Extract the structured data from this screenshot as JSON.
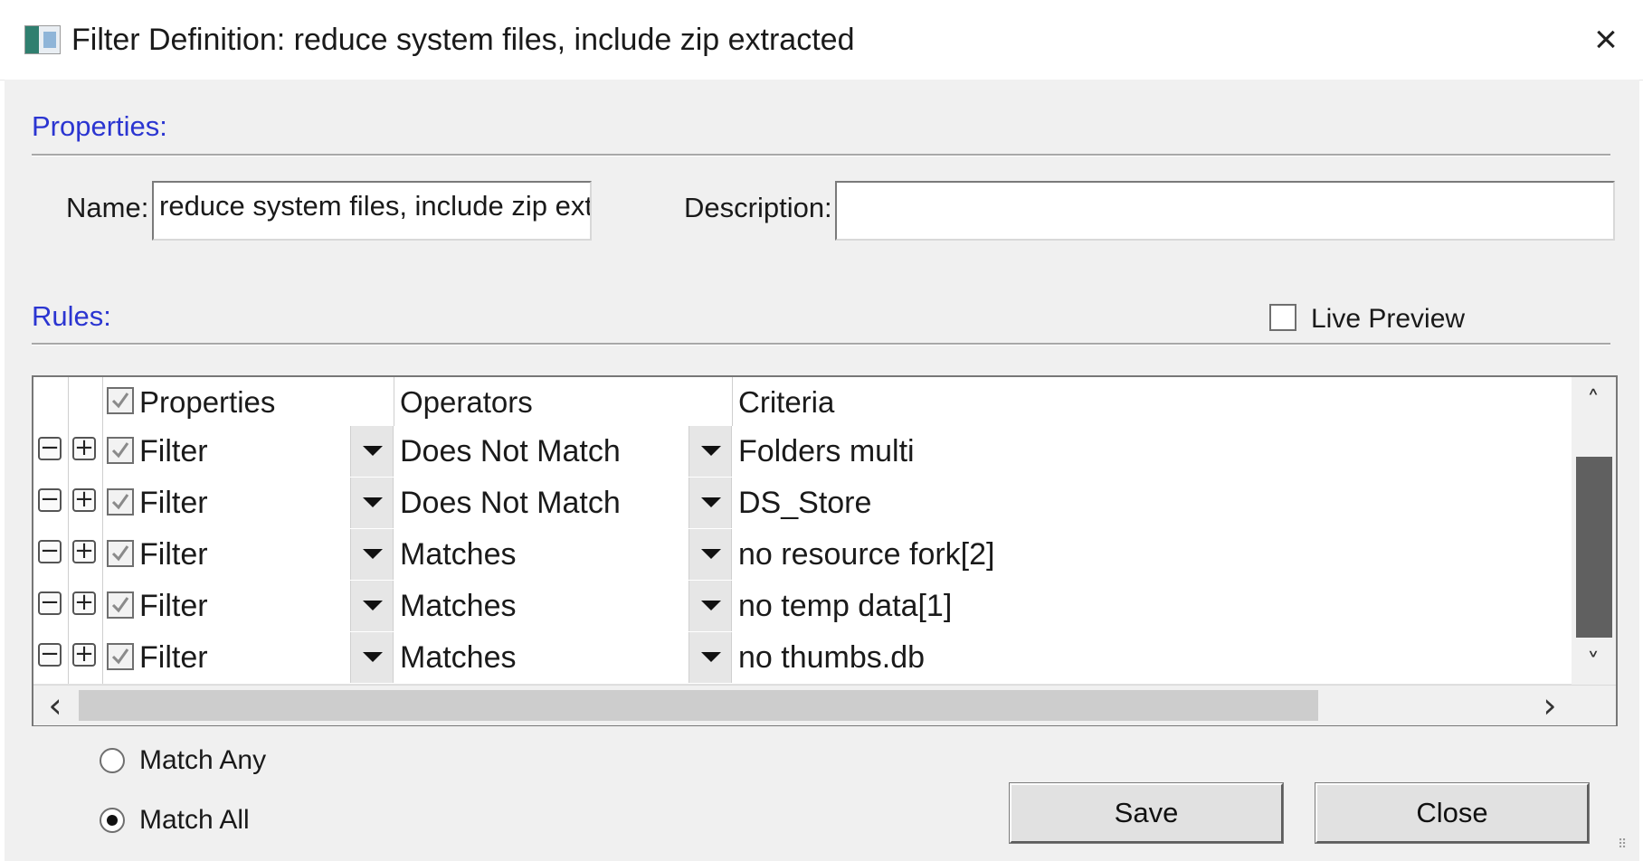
{
  "window": {
    "title": "Filter Definition: reduce system files, include zip extracted",
    "close_glyph": "×"
  },
  "properties": {
    "section_label": "Properties:",
    "name_label": "Name:",
    "name_value": "reduce system files, include zip extra",
    "description_label": "Description:",
    "description_value": ""
  },
  "rules": {
    "section_label": "Rules:",
    "live_preview_label": "Live Preview",
    "live_preview_checked": false,
    "columns": [
      "Properties",
      "Operators",
      "Criteria"
    ],
    "header_checkbox_checked": true,
    "rows": [
      {
        "property": "Filter",
        "operator": "Does Not Match",
        "criteria": "Folders multi",
        "checked": true
      },
      {
        "property": "Filter",
        "operator": "Does Not Match",
        "criteria": "DS_Store",
        "checked": true
      },
      {
        "property": "Filter",
        "operator": "Matches",
        "criteria": "no resource fork[2]",
        "checked": true
      },
      {
        "property": "Filter",
        "operator": "Matches",
        "criteria": "no temp data[1]",
        "checked": true
      },
      {
        "property": "Filter",
        "operator": "Matches",
        "criteria": "no thumbs.db",
        "checked": true
      }
    ],
    "remove_glyph": "−",
    "add_glyph": "+",
    "scroll_up_glyph": "˄",
    "scroll_down_glyph": "˅",
    "scroll_left_glyph": "‹",
    "scroll_right_glyph": "›"
  },
  "match": {
    "any_label": "Match Any",
    "all_label": "Match All",
    "selected": "all"
  },
  "buttons": {
    "save_label": "Save",
    "close_label": "Close"
  },
  "colors": {
    "section_title": "#2b35d1",
    "dialog_bg": "#f0f0f0",
    "scroll_thumb": "#606060"
  }
}
